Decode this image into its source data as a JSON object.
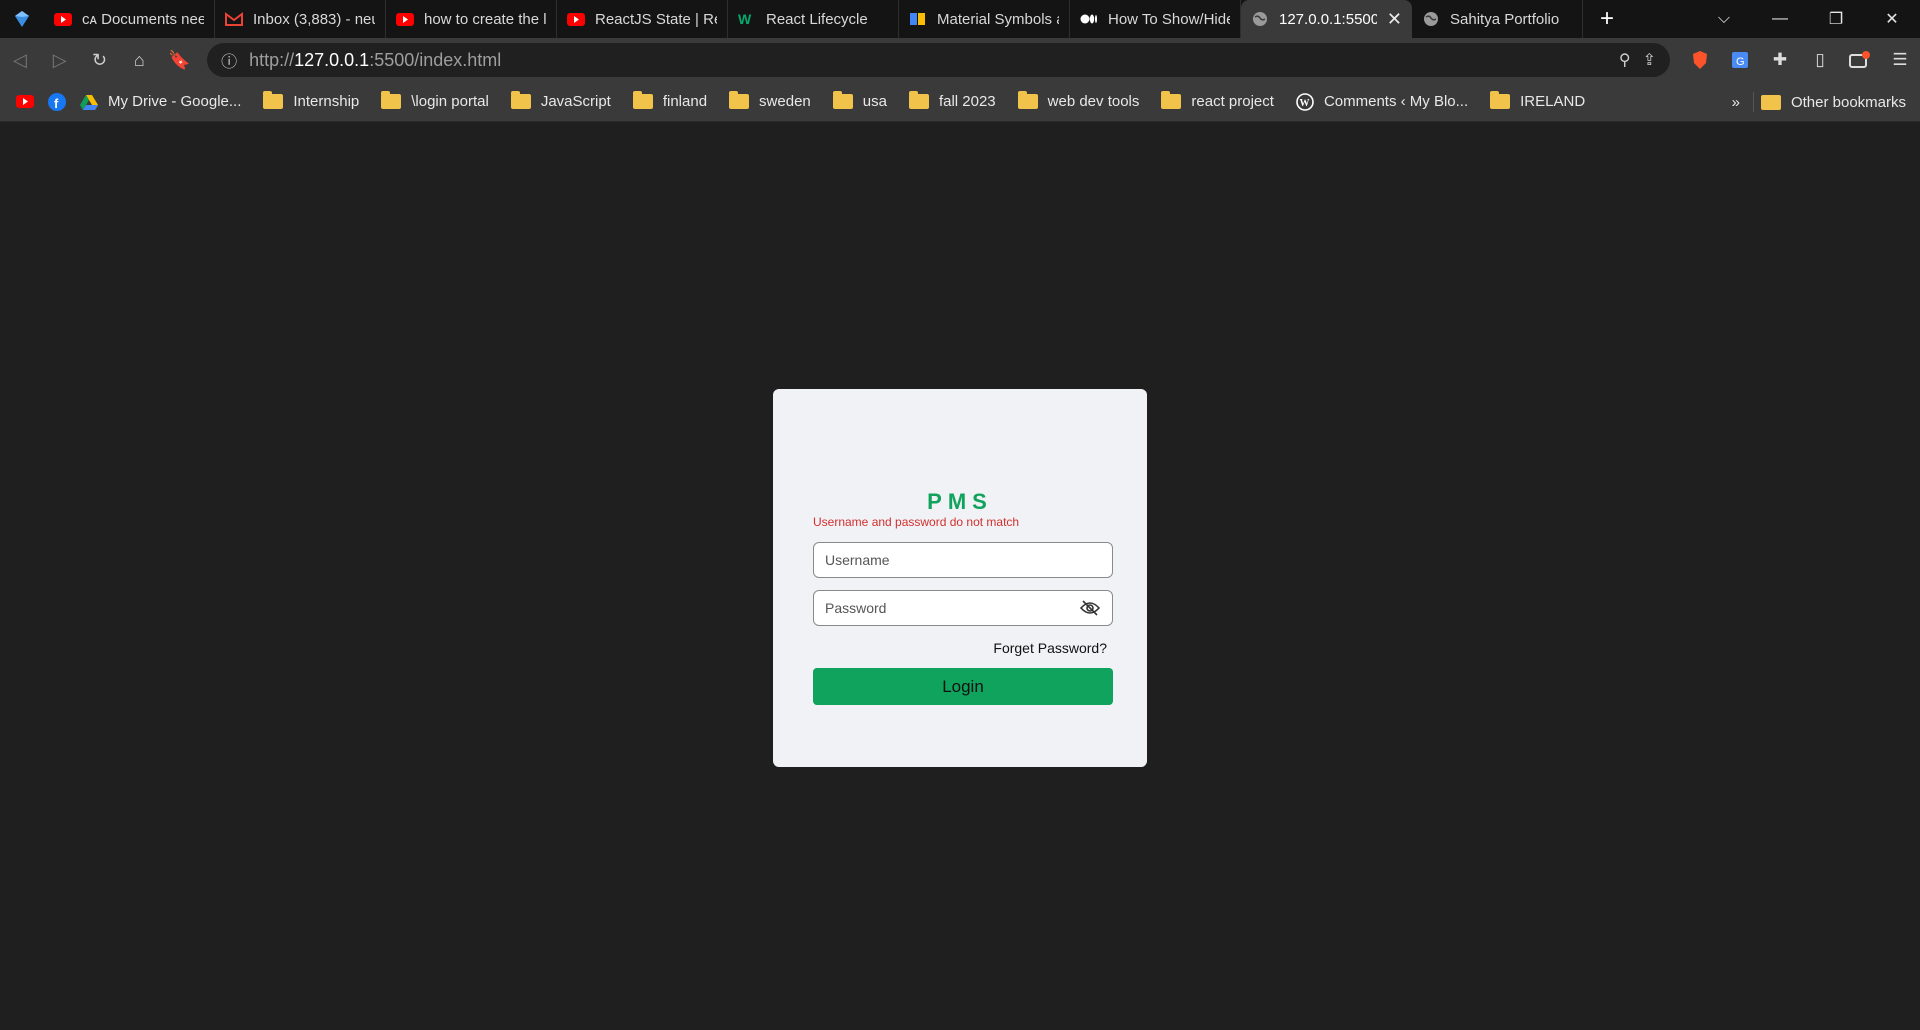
{
  "browser": {
    "tabs": [
      {
        "title": "ᴄᴀ Documents nee",
        "icon": "youtube-icon",
        "active": false
      },
      {
        "title": "Inbox (3,883) - neu",
        "icon": "gmail-icon",
        "active": false
      },
      {
        "title": "how to create the l",
        "icon": "youtube-icon",
        "active": false
      },
      {
        "title": "ReactJS State | Rea",
        "icon": "youtube-icon",
        "active": false
      },
      {
        "title": "React Lifecycle",
        "icon": "w3-icon",
        "active": false
      },
      {
        "title": "Material Symbols a",
        "icon": "material-icon",
        "active": false
      },
      {
        "title": "How To Show/Hide",
        "icon": "medium-icon",
        "active": false
      },
      {
        "title": "127.0.0.1:5500/",
        "icon": "globe-icon",
        "active": true
      },
      {
        "title": "Sahitya Portfolio",
        "icon": "globe-icon",
        "active": false
      }
    ],
    "url": {
      "prefix": "http://",
      "host": "127.0.0.1",
      "rest": ":5500/index.html"
    },
    "bookmarks": [
      {
        "label": "",
        "icon": "youtube-icon"
      },
      {
        "label": "",
        "icon": "facebook-icon"
      },
      {
        "label": "My Drive - Google...",
        "icon": "drive-icon"
      },
      {
        "label": "Internship",
        "icon": "folder-icon"
      },
      {
        "label": "\\login portal",
        "icon": "folder-icon"
      },
      {
        "label": "JavaScript",
        "icon": "folder-icon"
      },
      {
        "label": "finland",
        "icon": "folder-icon"
      },
      {
        "label": "sweden",
        "icon": "folder-icon"
      },
      {
        "label": "usa",
        "icon": "folder-icon"
      },
      {
        "label": "fall 2023",
        "icon": "folder-icon"
      },
      {
        "label": "web dev tools",
        "icon": "folder-icon"
      },
      {
        "label": "react project",
        "icon": "folder-icon"
      },
      {
        "label": "Comments ‹ My Blo...",
        "icon": "wordpress-icon"
      },
      {
        "label": "IRELAND",
        "icon": "folder-icon"
      }
    ],
    "more_label": "»",
    "other_bookmarks": "Other bookmarks"
  },
  "login": {
    "title": "PMS",
    "error": "Username and password do not match",
    "username_placeholder": "Username",
    "password_placeholder": "Password",
    "forgot": "Forget Password?",
    "button": "Login"
  },
  "colors": {
    "accent": "#10a35e",
    "error": "#d32f2f",
    "background": "#1f1f1f",
    "card": "#f0f2f5"
  }
}
